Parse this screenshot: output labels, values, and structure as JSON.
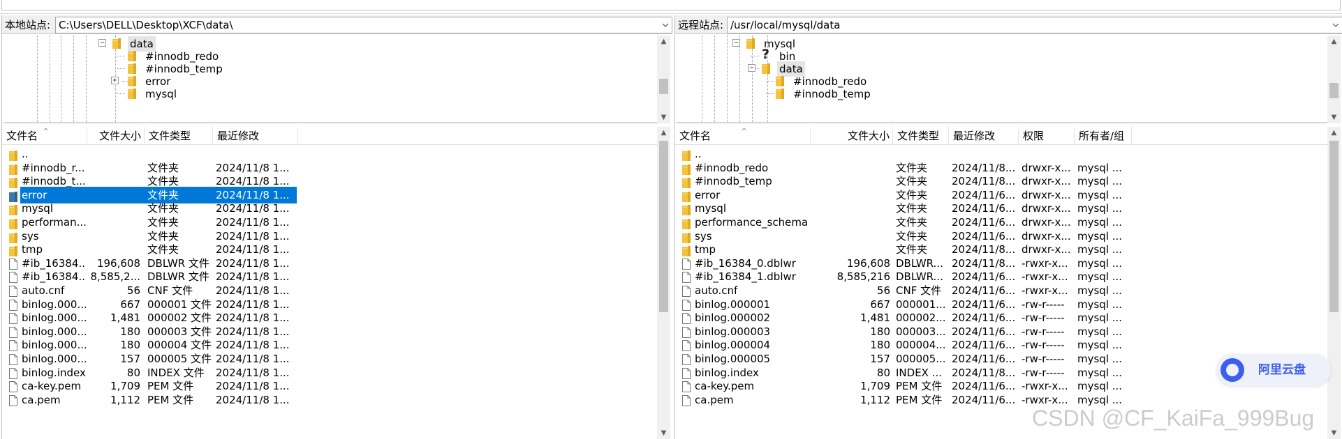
{
  "left": {
    "site_label": "本地站点:",
    "path": "C:\\Users\\DELL\\Desktop\\XCF\\data\\",
    "tree": [
      {
        "label": "data",
        "highlight": true
      },
      {
        "label": "#innodb_redo"
      },
      {
        "label": "#innodb_temp"
      },
      {
        "label": "error"
      },
      {
        "label": "mysql"
      }
    ],
    "columns": [
      "文件名",
      "文件大小",
      "文件类型",
      "最近修改"
    ],
    "rows": [
      {
        "name": "..",
        "size": "",
        "type": "",
        "modified": "",
        "icon": "folder"
      },
      {
        "name": "#innodb_r...",
        "size": "",
        "type": "文件夹",
        "modified": "2024/11/8 1...",
        "icon": "folder"
      },
      {
        "name": "#innodb_t...",
        "size": "",
        "type": "文件夹",
        "modified": "2024/11/8 1...",
        "icon": "folder"
      },
      {
        "name": "error",
        "size": "",
        "type": "文件夹",
        "modified": "2024/11/8 1...",
        "icon": "folder",
        "selected": true
      },
      {
        "name": "mysql",
        "size": "",
        "type": "文件夹",
        "modified": "2024/11/8 1...",
        "icon": "folder"
      },
      {
        "name": "performan...",
        "size": "",
        "type": "文件夹",
        "modified": "2024/11/8 1...",
        "icon": "folder"
      },
      {
        "name": "sys",
        "size": "",
        "type": "文件夹",
        "modified": "2024/11/8 1...",
        "icon": "folder"
      },
      {
        "name": "tmp",
        "size": "",
        "type": "文件夹",
        "modified": "2024/11/8 1...",
        "icon": "folder"
      },
      {
        "name": "#ib_16384...",
        "size": "196,608",
        "type": "DBLWR 文件",
        "modified": "2024/11/8 1...",
        "icon": "file"
      },
      {
        "name": "#ib_16384...",
        "size": "8,585,2...",
        "type": "DBLWR 文件",
        "modified": "2024/11/8 1...",
        "icon": "file"
      },
      {
        "name": "auto.cnf",
        "size": "56",
        "type": "CNF 文件",
        "modified": "2024/11/8 1...",
        "icon": "file"
      },
      {
        "name": "binlog.000...",
        "size": "667",
        "type": "000001 文件",
        "modified": "2024/11/8 1...",
        "icon": "file"
      },
      {
        "name": "binlog.000...",
        "size": "1,481",
        "type": "000002 文件",
        "modified": "2024/11/8 1...",
        "icon": "file"
      },
      {
        "name": "binlog.000...",
        "size": "180",
        "type": "000003 文件",
        "modified": "2024/11/8 1...",
        "icon": "file"
      },
      {
        "name": "binlog.000...",
        "size": "180",
        "type": "000004 文件",
        "modified": "2024/11/8 1...",
        "icon": "file"
      },
      {
        "name": "binlog.000...",
        "size": "157",
        "type": "000005 文件",
        "modified": "2024/11/8 1...",
        "icon": "file"
      },
      {
        "name": "binlog.index",
        "size": "80",
        "type": "INDEX 文件",
        "modified": "2024/11/8 1...",
        "icon": "file"
      },
      {
        "name": "ca-key.pem",
        "size": "1,709",
        "type": "PEM 文件",
        "modified": "2024/11/8 1...",
        "icon": "file"
      },
      {
        "name": "ca.pem",
        "size": "1,112",
        "type": "PEM 文件",
        "modified": "2024/11/8 1...",
        "icon": "file"
      }
    ]
  },
  "right": {
    "site_label": "远程站点:",
    "path": "/usr/local/mysql/data",
    "tree": [
      {
        "label": "mysql"
      },
      {
        "label": "bin",
        "icon": "question"
      },
      {
        "label": "data",
        "highlight": true
      },
      {
        "label": "#innodb_redo"
      },
      {
        "label": "#innodb_temp"
      }
    ],
    "columns": [
      "文件名",
      "文件大小",
      "文件类型",
      "最近修改",
      "权限",
      "所有者/组"
    ],
    "rows": [
      {
        "name": "..",
        "size": "",
        "type": "",
        "modified": "",
        "perms": "",
        "owner": "",
        "icon": "folder"
      },
      {
        "name": "#innodb_redo",
        "size": "",
        "type": "文件夹",
        "modified": "2024/11/8...",
        "perms": "drwxr-x...",
        "owner": "mysql ...",
        "icon": "folder"
      },
      {
        "name": "#innodb_temp",
        "size": "",
        "type": "文件夹",
        "modified": "2024/11/8...",
        "perms": "drwxr-x...",
        "owner": "mysql ...",
        "icon": "folder"
      },
      {
        "name": "error",
        "size": "",
        "type": "文件夹",
        "modified": "2024/11/6...",
        "perms": "drwxr-x...",
        "owner": "mysql ...",
        "icon": "folder"
      },
      {
        "name": "mysql",
        "size": "",
        "type": "文件夹",
        "modified": "2024/11/6...",
        "perms": "drwxr-x...",
        "owner": "mysql ...",
        "icon": "folder"
      },
      {
        "name": "performance_schema",
        "size": "",
        "type": "文件夹",
        "modified": "2024/11/6...",
        "perms": "drwxr-x...",
        "owner": "mysql ...",
        "icon": "folder"
      },
      {
        "name": "sys",
        "size": "",
        "type": "文件夹",
        "modified": "2024/11/6...",
        "perms": "drwxr-x...",
        "owner": "mysql ...",
        "icon": "folder"
      },
      {
        "name": "tmp",
        "size": "",
        "type": "文件夹",
        "modified": "2024/11/8...",
        "perms": "drwxr-x...",
        "owner": "mysql ...",
        "icon": "folder"
      },
      {
        "name": "#ib_16384_0.dblwr",
        "size": "196,608",
        "type": "DBLWR...",
        "modified": "2024/11/8...",
        "perms": "-rwxr-x...",
        "owner": "mysql ...",
        "icon": "file"
      },
      {
        "name": "#ib_16384_1.dblwr",
        "size": "8,585,216",
        "type": "DBLWR...",
        "modified": "2024/11/6...",
        "perms": "-rwxr-x...",
        "owner": "mysql ...",
        "icon": "file"
      },
      {
        "name": "auto.cnf",
        "size": "56",
        "type": "CNF 文件",
        "modified": "2024/11/6...",
        "perms": "-rwxr-x...",
        "owner": "mysql ...",
        "icon": "file"
      },
      {
        "name": "binlog.000001",
        "size": "667",
        "type": "000001...",
        "modified": "2024/11/6...",
        "perms": "-rw-r-----",
        "owner": "mysql ...",
        "icon": "file"
      },
      {
        "name": "binlog.000002",
        "size": "1,481",
        "type": "000002...",
        "modified": "2024/11/6...",
        "perms": "-rw-r-----",
        "owner": "mysql ...",
        "icon": "file"
      },
      {
        "name": "binlog.000003",
        "size": "180",
        "type": "000003...",
        "modified": "2024/11/6...",
        "perms": "-rw-r-----",
        "owner": "mysql ...",
        "icon": "file"
      },
      {
        "name": "binlog.000004",
        "size": "180",
        "type": "000004...",
        "modified": "2024/11/6...",
        "perms": "-rw-r-----",
        "owner": "mysql ...",
        "icon": "file"
      },
      {
        "name": "binlog.000005",
        "size": "157",
        "type": "000005...",
        "modified": "2024/11/6...",
        "perms": "-rw-r-----",
        "owner": "mysql ...",
        "icon": "file"
      },
      {
        "name": "binlog.index",
        "size": "80",
        "type": "INDEX ...",
        "modified": "2024/11/8...",
        "perms": "-rw-r-----",
        "owner": "mysql ...",
        "icon": "file"
      },
      {
        "name": "ca-key.pem",
        "size": "1,709",
        "type": "PEM 文件",
        "modified": "2024/11/6...",
        "perms": "-rwxr-x...",
        "owner": "mysql ...",
        "icon": "file"
      },
      {
        "name": "ca.pem",
        "size": "1,112",
        "type": "PEM 文件",
        "modified": "2024/11/6...",
        "perms": "-rwxr-x...",
        "owner": "mysql ...",
        "icon": "file"
      }
    ]
  },
  "badge": {
    "label": "阿里云盘"
  },
  "watermark": {
    "text": "CSDN @CF_KaiFa_999Bug"
  },
  "colors": {
    "selection": "#0078d7",
    "folder": "#f3c33e",
    "badge_accent": "#3b5ef0"
  },
  "icons": {
    "folder": "folder-icon",
    "file": "file-icon",
    "unknown": "question-icon",
    "sort": "sort-asc-icon",
    "dropdown": "chevron-down-icon"
  }
}
